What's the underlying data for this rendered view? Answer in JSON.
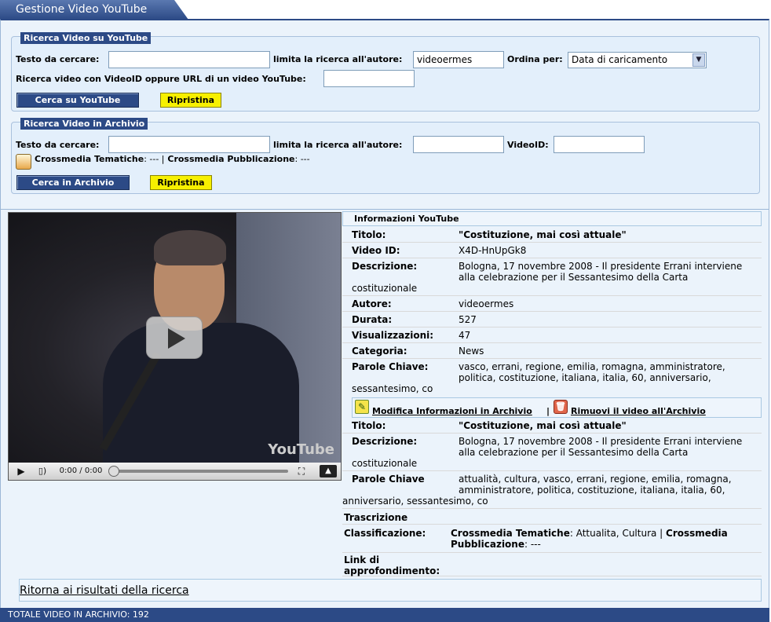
{
  "header": {
    "tab_title": "Gestione Video YouTube"
  },
  "youtube_search": {
    "legend": "Ricerca Video su YouTube",
    "text_label": "Testo da cercare:",
    "text_value": "",
    "author_label": "limita la ricerca all'autore:",
    "author_value": "videoermes",
    "order_label": "Ordina per:",
    "order_value": "Data di caricamento",
    "videoid_label": "Ricerca video con VideoID oppure URL di un video YouTube:",
    "videoid_value": "",
    "search_button": "Cerca su YouTube",
    "reset_button": "Ripristina"
  },
  "archive_search": {
    "legend": "Ricerca Video in Archivio",
    "text_label": "Testo da cercare:",
    "author_label": "limita la ricerca all'autore:",
    "videoid_label": "VideoID:",
    "crossmedia_tematiche_label": "Crossmedia Tematiche",
    "crossmedia_tematiche_value": ": --- |",
    "crossmedia_pubblicazione_label": "Crossmedia Pubblicazione",
    "crossmedia_pubblicazione_value": ": ---",
    "search_button": "Cerca in Archivio",
    "reset_button": "Ripristina"
  },
  "player": {
    "time": "0:00 / 0:00",
    "logo_text": "YouTube"
  },
  "youtube_info": {
    "heading": "Informazioni YouTube",
    "titolo_label": "Titolo:",
    "titolo_value": "\"Costituzione, mai così attuale\"",
    "videoid_label": "Video ID:",
    "videoid_value": "X4D-HnUpGk8",
    "descrizione_label": "Descrizione:",
    "descrizione_value": "Bologna, 17 novembre 2008 - Il presidente Errani interviene alla celebrazione per il Sessantesimo della Carta",
    "descrizione_wrap": "costituzionale",
    "autore_label": "Autore:",
    "autore_value": "videoermes",
    "durata_label": "Durata:",
    "durata_value": "527",
    "visualizzazioni_label": "Visualizzazioni:",
    "visualizzazioni_value": "47",
    "categoria_label": "Categoria:",
    "categoria_value": "News",
    "parole_label": "Parole Chiave:",
    "parole_value": "vasco, errani, regione, emilia, romagna, amministratore, politica, costituzione, italiana, italia, 60, anniversario,",
    "parole_wrap": "sessantesimo, co"
  },
  "archive_actions": {
    "edit_link": "Modifica Informazioni in Archivio",
    "separator": "|",
    "remove_link": "Rimuovi il video all'Archivio"
  },
  "archive_info": {
    "titolo_label": "Titolo:",
    "titolo_value": "\"Costituzione, mai così attuale\"",
    "descrizione_label": "Descrizione:",
    "descrizione_value": "Bologna, 17 novembre 2008 - Il presidente Errani interviene alla celebrazione per il Sessantesimo della Carta",
    "descrizione_wrap": "costituzionale",
    "parole_label": "Parole Chiave",
    "parole_value": "attualità, cultura, vasco, errani, regione, emilia, romagna, amministratore, politica, costituzione, italiana, italia, 60,",
    "parole_wrap": "anniversario, sessantesimo, co",
    "trascrizione_label": "Trascrizione",
    "classificazione_label": "Classificazione:",
    "class_tematiche_label": "Crossmedia Tematiche",
    "class_tematiche_value": ": Attualita, Cultura |",
    "class_pubblicazione_label": "Crossmedia Pubblicazione",
    "class_pubblicazione_value": ": ---",
    "link_label": "Link di approfondimento:"
  },
  "back_link": "Ritorna ai risultati della ricerca",
  "footer": {
    "total": "TOTALE VIDEO IN ARCHIVIO: 192"
  }
}
